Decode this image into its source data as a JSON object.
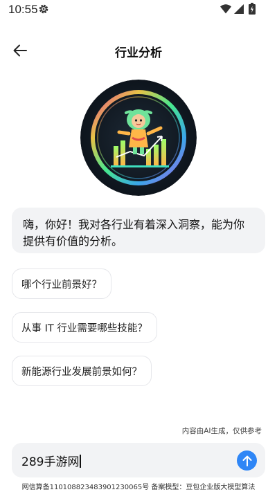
{
  "status_bar": {
    "time": "10:55",
    "icons": [
      "gear-icon",
      "wifi-icon",
      "signal-icon",
      "battery-icon"
    ]
  },
  "header": {
    "title": "行业分析",
    "back_icon": "arrow-left-icon"
  },
  "greeting": "嗨，你好！我对各行业有着深入洞察，能为你提供有价值的分析。",
  "suggestions": [
    "哪个行业前景好？",
    "从事 IT 行业需要哪些技能？",
    "新能源行业发展前景如何？"
  ],
  "ai_note": "内容由AI生成，仅供参考",
  "input": {
    "value": "289手游网"
  },
  "send_icon": "arrow-up-icon",
  "footer": "网信算备110108823483901230065号 备案模型：豆包企业版大模型算法",
  "colors": {
    "accent": "#2f86f6",
    "bubble_bg": "#f2f3f5",
    "avatar_bg": "#121a24"
  }
}
